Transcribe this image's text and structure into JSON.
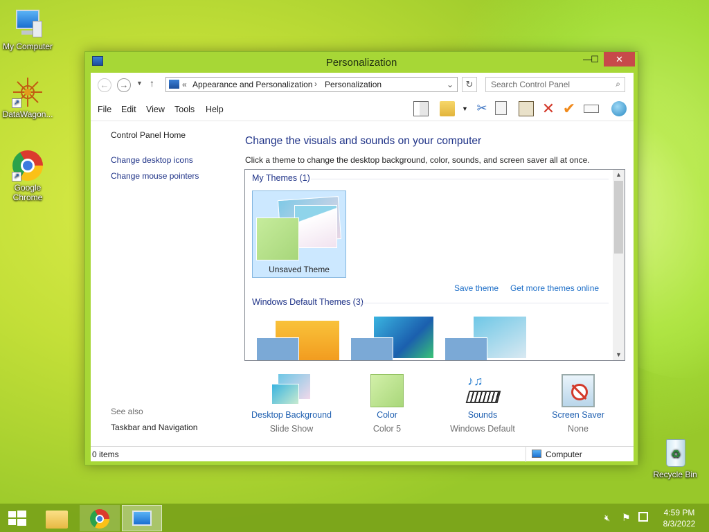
{
  "desktop": {
    "icons": [
      {
        "label": "My Computer"
      },
      {
        "label": "DataWagon..."
      },
      {
        "label": "Google Chrome"
      },
      {
        "label": "Recycle Bin"
      }
    ]
  },
  "window": {
    "title": "Personalization",
    "address": {
      "overflow": "«",
      "crumbs": [
        "Appearance and Personalization",
        "Personalization"
      ],
      "separator": "›"
    },
    "search": {
      "placeholder": "Search Control Panel"
    },
    "menu": [
      "File",
      "Edit",
      "View",
      "Tools",
      "Help"
    ],
    "sidebar": {
      "home": "Control Panel Home",
      "links": [
        "Change desktop icons",
        "Change mouse pointers"
      ],
      "see_also_label": "See also",
      "see_also": [
        "Taskbar and Navigation"
      ]
    },
    "main": {
      "heading": "Change the visuals and sounds on your computer",
      "description": "Click a theme to change the desktop background, color, sounds, and screen saver all at once.",
      "my_themes_header": "My Themes (1)",
      "unsaved_theme": "Unsaved Theme",
      "save_theme": "Save theme",
      "get_more": "Get more themes online",
      "default_themes_header": "Windows Default Themes (3)"
    },
    "bottom": [
      {
        "label": "Desktop Background",
        "sub": "Slide Show"
      },
      {
        "label": "Color",
        "sub": "Color 5"
      },
      {
        "label": "Sounds",
        "sub": "Windows Default"
      },
      {
        "label": "Screen Saver",
        "sub": "None"
      }
    ],
    "status": {
      "items": "0 items",
      "location": "Computer"
    }
  },
  "taskbar": {
    "time": "4:59 PM",
    "date": "8/3/2022"
  },
  "colors": {
    "accent": "#a7d736",
    "link": "#1e3287",
    "selection": "#cce8ff"
  }
}
